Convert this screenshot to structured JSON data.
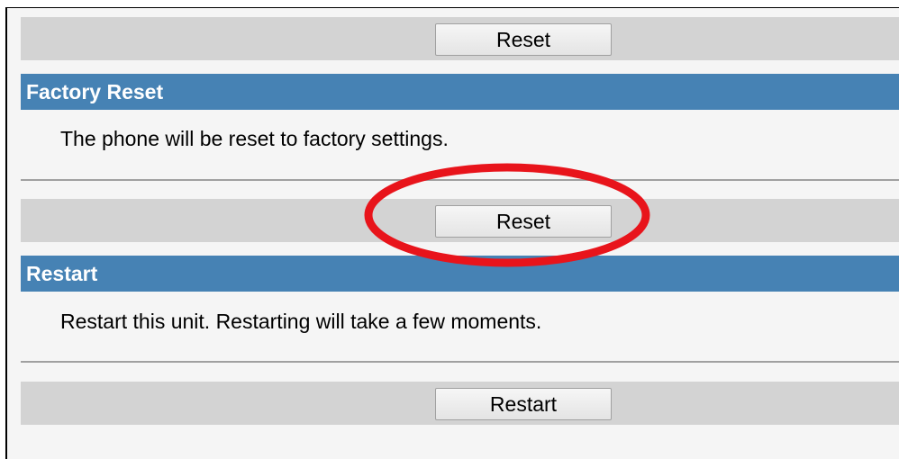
{
  "top_bar": {
    "button_label": "Reset"
  },
  "factory_reset": {
    "title": "Factory Reset",
    "description": "The phone will be reset to factory settings.",
    "button_label": "Reset"
  },
  "restart": {
    "title": "Restart",
    "description": "Restart this unit. Restarting will take a few moments.",
    "button_label": "Restart"
  },
  "colors": {
    "header_bg": "#4682b4",
    "bar_bg": "#d3d3d3",
    "highlight": "#e8141b"
  }
}
